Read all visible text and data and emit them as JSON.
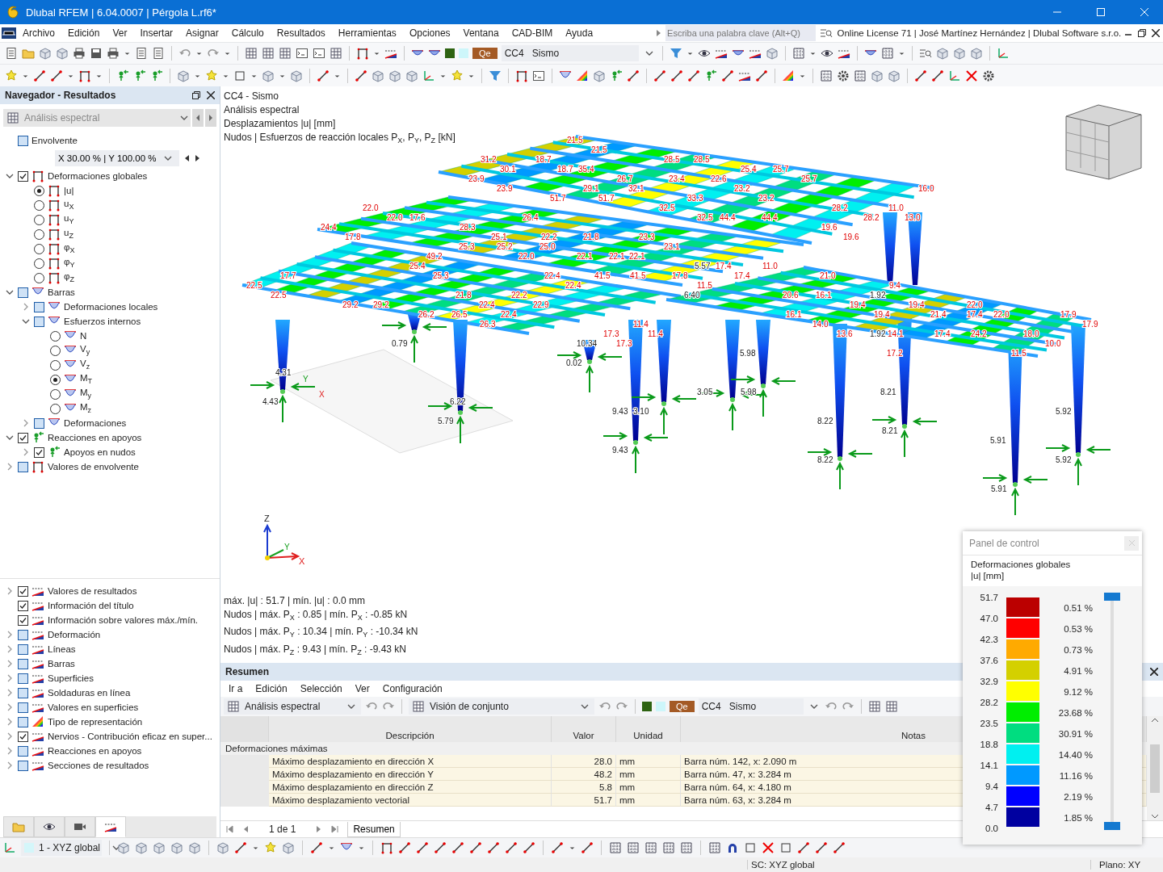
{
  "window": {
    "title": "Dlubal RFEM | 6.04.0007 | Pérgola L.rf6*"
  },
  "menu": [
    "Archivo",
    "Edición",
    "Ver",
    "Insertar",
    "Asignar",
    "Cálculo",
    "Resultados",
    "Herramientas",
    "Opciones",
    "Ventana",
    "CAD-BIM",
    "Ayuda"
  ],
  "search": {
    "placeholder": "Escriba una palabra clave (Alt+Q)"
  },
  "license": "Online License 71 | José Martínez Hernández | Dlubal Software s.r.o.",
  "load_selector": {
    "type": "Qe",
    "case": "CC4",
    "name": "Sismo"
  },
  "navigator": {
    "title": "Navegador - Resultados",
    "analysis": "Análisis espectral",
    "envelope": {
      "label": "Envolvente",
      "checked": false
    },
    "envelope_factors": "X 30.00 % | Y 100.00 %",
    "tree": [
      {
        "label": "Deformaciones globales",
        "kind": "deformation",
        "checked": true,
        "expanded": true,
        "children": [
          {
            "label": "|u|",
            "kind": "deformation",
            "selected": true
          },
          {
            "label": "u$_{X}$",
            "kind": "deformation",
            "selected": false
          },
          {
            "label": "u$_{Y}$",
            "kind": "deformation",
            "selected": false
          },
          {
            "label": "u$_{Z}$",
            "kind": "deformation",
            "selected": false
          },
          {
            "label": "φ$_{X}$",
            "kind": "deformation",
            "selected": false
          },
          {
            "label": "φ$_{Y}$",
            "kind": "deformation",
            "selected": false
          },
          {
            "label": "φ$_{Z}$",
            "kind": "deformation",
            "selected": false
          }
        ]
      },
      {
        "label": "Barras",
        "kind": "member",
        "checked": false,
        "expanded": true,
        "children": [
          {
            "label": "Deformaciones locales",
            "kind": "member",
            "checked": false,
            "expanded": false
          },
          {
            "label": "Esfuerzos internos",
            "kind": "member",
            "checked": false,
            "expanded": true,
            "children": [
              {
                "label": "N",
                "kind": "member",
                "selected": false
              },
              {
                "label": "V$_{y}$",
                "kind": "member",
                "selected": false
              },
              {
                "label": "V$_{z}$",
                "kind": "member",
                "selected": false
              },
              {
                "label": "M$_{T}$",
                "kind": "member",
                "selected": true
              },
              {
                "label": "M$_{y}$",
                "kind": "member",
                "selected": false
              },
              {
                "label": "M$_{z}$",
                "kind": "member",
                "selected": false
              }
            ]
          },
          {
            "label": "Deformaciones",
            "kind": "member",
            "checked": false,
            "expanded": false
          }
        ]
      },
      {
        "label": "Reacciones en apoyos",
        "kind": "reaction",
        "checked": true,
        "expanded": true,
        "children": [
          {
            "label": "Apoyos en nudos",
            "kind": "reaction",
            "checked": true,
            "expanded": false
          }
        ]
      },
      {
        "label": "Valores de envolvente",
        "kind": "deformation",
        "checked": false,
        "expanded": false
      }
    ],
    "display": [
      {
        "label": "Valores de resultados",
        "kind": "values",
        "checked": true,
        "expanded": false
      },
      {
        "label": "Información del título",
        "kind": "display",
        "checked": true
      },
      {
        "label": "Información sobre valores máx./mín.",
        "kind": "display",
        "checked": true
      },
      {
        "label": "Deformación",
        "kind": "display",
        "checked": false,
        "expanded": false
      },
      {
        "label": "Líneas",
        "kind": "display",
        "checked": false,
        "expanded": false
      },
      {
        "label": "Barras",
        "kind": "display",
        "checked": false,
        "expanded": false
      },
      {
        "label": "Superficies",
        "kind": "display",
        "checked": false,
        "expanded": false
      },
      {
        "label": "Soldaduras en línea",
        "kind": "display",
        "checked": false,
        "expanded": false
      },
      {
        "label": "Valores en superficies",
        "kind": "display",
        "checked": false,
        "expanded": false
      },
      {
        "label": "Tipo de representación",
        "kind": "colors",
        "checked": false,
        "expanded": false
      },
      {
        "label": "Nervios - Contribución eficaz en super...",
        "kind": "display",
        "checked": true,
        "expanded": false
      },
      {
        "label": "Reacciones en apoyos",
        "kind": "display",
        "checked": false,
        "expanded": false
      },
      {
        "label": "Secciones de resultados",
        "kind": "display",
        "checked": false,
        "expanded": false
      }
    ],
    "tabs": [
      {
        "kind": "data",
        "selected": false
      },
      {
        "kind": "view",
        "selected": false
      },
      {
        "kind": "camera",
        "selected": false
      },
      {
        "kind": "results",
        "selected": true
      }
    ]
  },
  "viewport": {
    "info": [
      "CC4 - Sismo",
      "Análisis espectral",
      "Desplazamientos |u| [mm]",
      "Nudos | Esfuerzos de reacción locales P$_{X}$, P$_{Y}$, P$_{Z}$ [kN]"
    ],
    "extremes": [
      "máx. |u| : 51.7 | mín. |u| : 0.0 mm",
      "Nudos | máx. P$_{X}$ : 0.85 | mín. P$_{X}$ : -0.85 kN",
      "Nudos | máx. P$_{Y}$ : 10.34 | mín. P$_{Y}$ : -10.34 kN",
      "Nudos | máx. P$_{Z}$ : 9.43 | mín. P$_{Z}$ : -9.43 kN"
    ],
    "axes": [
      "Z",
      "Y",
      "X"
    ],
    "support_axes": [
      "Y",
      "X"
    ],
    "labels": [
      {
        "text": "21.5",
        "kind": "deformation"
      },
      {
        "text": "21.5",
        "kind": "deformation"
      },
      {
        "text": "31.2",
        "kind": "deformation"
      },
      {
        "text": "18.7",
        "kind": "deformation"
      },
      {
        "text": "28.5",
        "kind": "deformation"
      },
      {
        "text": "28.5",
        "kind": "deformation"
      },
      {
        "text": "30.1",
        "kind": "deformation"
      },
      {
        "text": "18.7",
        "kind": "deformation"
      },
      {
        "text": "35.4",
        "kind": "deformation"
      },
      {
        "text": "25.4",
        "kind": "deformation"
      },
      {
        "text": "25.7",
        "kind": "deformation"
      },
      {
        "text": "23.9",
        "kind": "deformation"
      },
      {
        "text": "26.7",
        "kind": "deformation"
      },
      {
        "text": "23.4",
        "kind": "deformation"
      },
      {
        "text": "22.6",
        "kind": "deformation"
      },
      {
        "text": "25.7",
        "kind": "deformation"
      },
      {
        "text": "23.9",
        "kind": "deformation"
      },
      {
        "text": "29.1",
        "kind": "deformation"
      },
      {
        "text": "32.1",
        "kind": "deformation"
      },
      {
        "text": "23.2",
        "kind": "deformation"
      },
      {
        "text": "16.0",
        "kind": "deformation"
      },
      {
        "text": "51.7",
        "kind": "deformation"
      },
      {
        "text": "51.7",
        "kind": "deformation"
      },
      {
        "text": "33.3",
        "kind": "deformation"
      },
      {
        "text": "23.2",
        "kind": "deformation"
      },
      {
        "text": "22.0",
        "kind": "deformation"
      },
      {
        "text": "32.5",
        "kind": "deformation"
      },
      {
        "text": "28.2",
        "kind": "deformation"
      },
      {
        "text": "11.0",
        "kind": "deformation"
      },
      {
        "text": "22.0",
        "kind": "deformation"
      },
      {
        "text": "17.6",
        "kind": "deformation"
      },
      {
        "text": "26.4",
        "kind": "deformation"
      },
      {
        "text": "32.5",
        "kind": "deformation"
      },
      {
        "text": "44.4",
        "kind": "deformation"
      },
      {
        "text": "44.4",
        "kind": "deformation"
      },
      {
        "text": "28.2",
        "kind": "deformation"
      },
      {
        "text": "13.0",
        "kind": "deformation"
      },
      {
        "text": "24.4",
        "kind": "deformation"
      },
      {
        "text": "28.3",
        "kind": "deformation"
      },
      {
        "text": "19.6",
        "kind": "deformation"
      },
      {
        "text": "17.8",
        "kind": "deformation"
      },
      {
        "text": "25.1",
        "kind": "deformation"
      },
      {
        "text": "22.2",
        "kind": "deformation"
      },
      {
        "text": "21.8",
        "kind": "deformation"
      },
      {
        "text": "23.3",
        "kind": "deformation"
      },
      {
        "text": "19.6",
        "kind": "deformation"
      },
      {
        "text": "25.3",
        "kind": "deformation"
      },
      {
        "text": "25.2",
        "kind": "deformation"
      },
      {
        "text": "25.0",
        "kind": "deformation"
      },
      {
        "text": "23.1",
        "kind": "deformation"
      },
      {
        "text": "49.2",
        "kind": "deformation"
      },
      {
        "text": "22.0",
        "kind": "deformation"
      },
      {
        "text": "22.1",
        "kind": "deformation"
      },
      {
        "text": "22.1",
        "kind": "deformation"
      },
      {
        "text": "22.1",
        "kind": "deformation"
      },
      {
        "text": "25.4",
        "kind": "deformation"
      },
      {
        "text": "5.57",
        "kind": "reaction"
      },
      {
        "text": "17.4",
        "kind": "deformation"
      },
      {
        "text": "11.0",
        "kind": "deformation"
      },
      {
        "text": "17.7",
        "kind": "deformation"
      },
      {
        "text": "25.3",
        "kind": "deformation"
      },
      {
        "text": "22.4",
        "kind": "deformation"
      },
      {
        "text": "41.5",
        "kind": "deformation"
      },
      {
        "text": "41.5",
        "kind": "deformation"
      },
      {
        "text": "17.8",
        "kind": "deformation"
      },
      {
        "text": "17.4",
        "kind": "deformation"
      },
      {
        "text": "21.0",
        "kind": "deformation"
      },
      {
        "text": "22.5",
        "kind": "deformation"
      },
      {
        "text": "22.4",
        "kind": "deformation"
      },
      {
        "text": "11.5",
        "kind": "deformation"
      },
      {
        "text": "9.4",
        "kind": "deformation"
      },
      {
        "text": "22.5",
        "kind": "deformation"
      },
      {
        "text": "21.8",
        "kind": "deformation"
      },
      {
        "text": "22.2",
        "kind": "deformation"
      },
      {
        "text": "6.40",
        "kind": "reaction"
      },
      {
        "text": "20.6",
        "kind": "deformation"
      },
      {
        "text": "16.1",
        "kind": "deformation"
      },
      {
        "text": "1.92",
        "kind": "reaction"
      },
      {
        "text": "29.2",
        "kind": "deformation"
      },
      {
        "text": "29.2",
        "kind": "deformation"
      },
      {
        "text": "22.4",
        "kind": "deformation"
      },
      {
        "text": "22.9",
        "kind": "deformation"
      },
      {
        "text": "19.4",
        "kind": "deformation"
      },
      {
        "text": "19.4",
        "kind": "deformation"
      },
      {
        "text": "22.0",
        "kind": "deformation"
      },
      {
        "text": "26.2",
        "kind": "deformation"
      },
      {
        "text": "26.5",
        "kind": "deformation"
      },
      {
        "text": "22.4",
        "kind": "deformation"
      },
      {
        "text": "16.1",
        "kind": "deformation"
      },
      {
        "text": "19.4",
        "kind": "deformation"
      },
      {
        "text": "21.4",
        "kind": "deformation"
      },
      {
        "text": "17.4",
        "kind": "deformation"
      },
      {
        "text": "22.0",
        "kind": "deformation"
      },
      {
        "text": "17.9",
        "kind": "deformation"
      },
      {
        "text": "26.3",
        "kind": "deformation"
      },
      {
        "text": "11.4",
        "kind": "deformation"
      },
      {
        "text": "14.0",
        "kind": "deformation"
      },
      {
        "text": "17.9",
        "kind": "deformation"
      },
      {
        "text": "17.3",
        "kind": "deformation"
      },
      {
        "text": "11.4",
        "kind": "deformation"
      },
      {
        "text": "13.6",
        "kind": "deformation"
      },
      {
        "text": "1.92",
        "kind": "reaction"
      },
      {
        "text": "14.1",
        "kind": "deformation"
      },
      {
        "text": "17.4",
        "kind": "deformation"
      },
      {
        "text": "24.2",
        "kind": "deformation"
      },
      {
        "text": "18.0",
        "kind": "deformation"
      },
      {
        "text": "0.79",
        "kind": "reaction"
      },
      {
        "text": "10.34",
        "kind": "reaction"
      },
      {
        "text": "17.3",
        "kind": "deformation"
      },
      {
        "text": "10.0",
        "kind": "deformation"
      },
      {
        "text": "5.98",
        "kind": "reaction"
      },
      {
        "text": "17.2",
        "kind": "deformation"
      },
      {
        "text": "11.5",
        "kind": "deformation"
      },
      {
        "text": "0.02",
        "kind": "reaction"
      },
      {
        "text": "4.31",
        "kind": "reaction"
      },
      {
        "text": "3.05",
        "kind": "reaction"
      },
      {
        "text": "5.98",
        "kind": "reaction"
      },
      {
        "text": "8.21",
        "kind": "reaction"
      },
      {
        "text": "4.43",
        "kind": "reaction"
      },
      {
        "text": "6.22",
        "kind": "reaction"
      },
      {
        "text": "9.43",
        "kind": "reaction"
      },
      {
        "text": "3.10",
        "kind": "reaction"
      },
      {
        "text": "5.92",
        "kind": "reaction"
      },
      {
        "text": "5.79",
        "kind": "reaction"
      },
      {
        "text": "8.22",
        "kind": "reaction"
      },
      {
        "text": "8.21",
        "kind": "reaction"
      },
      {
        "text": "5.91",
        "kind": "reaction"
      },
      {
        "text": "9.43",
        "kind": "reaction"
      },
      {
        "text": "8.22",
        "kind": "reaction"
      },
      {
        "text": "5.92",
        "kind": "reaction"
      },
      {
        "text": "5.91",
        "kind": "reaction"
      }
    ]
  },
  "summary": {
    "title": "Resumen",
    "menu": [
      "Ir a",
      "Edición",
      "Selección",
      "Ver",
      "Configuración"
    ],
    "analysis": "Análisis espectral",
    "view": "Visión de conjunto",
    "load_selector": {
      "type": "Qe",
      "case": "CC4",
      "name": "Sismo"
    },
    "columns": [
      "Descripción",
      "Valor",
      "Unidad",
      "Notas"
    ],
    "group": "Deformaciones máximas",
    "rows": [
      {
        "description": "Máximo desplazamiento en dirección X",
        "value": "28.0",
        "unit": "mm",
        "notes": "Barra núm. 142, x: 2.090 m"
      },
      {
        "description": "Máximo desplazamiento en dirección Y",
        "value": "48.2",
        "unit": "mm",
        "notes": "Barra núm. 47, x: 3.284 m"
      },
      {
        "description": "Máximo desplazamiento en dirección Z",
        "value": "5.8",
        "unit": "mm",
        "notes": "Barra núm. 64, x: 4.180 m"
      },
      {
        "description": "Máximo desplazamiento vectorial",
        "value": "51.7",
        "unit": "mm",
        "notes": "Barra núm. 63, x: 3.284 m"
      }
    ],
    "pager": "1 de 1",
    "tab": "Resumen"
  },
  "control_panel": {
    "title": "Panel de control",
    "slider": {
      "level": 1
    },
    "heading": "Deformaciones globales",
    "unit": "|u| [mm]",
    "scale": [
      "51.7",
      "47.0",
      "42.3",
      "37.6",
      "32.9",
      "28.2",
      "23.5",
      "18.8",
      "14.1",
      "9.4",
      "4.7",
      "0.0"
    ],
    "bands": [
      {
        "color": "#bb0000",
        "share": "0.51 %"
      },
      {
        "color": "#ff0000",
        "share": "0.53 %"
      },
      {
        "color": "#ffaa00",
        "share": "0.73 %"
      },
      {
        "color": "#d4d000",
        "share": "4.91 %"
      },
      {
        "color": "#ffff00",
        "share": "9.12 %"
      },
      {
        "color": "#00ee00",
        "share": "23.68 %"
      },
      {
        "color": "#00dd80",
        "share": "30.91 %"
      },
      {
        "color": "#00f0f0",
        "share": "14.40 %"
      },
      {
        "color": "#0099ff",
        "share": "11.16 %"
      },
      {
        "color": "#0000ff",
        "share": "2.19 %"
      },
      {
        "color": "#0000a0",
        "share": "1.85 %"
      }
    ]
  },
  "coordinate_system": "1 - XYZ global",
  "status": {
    "coordinate_system": "SC: XYZ global",
    "plane": "Plano: XY"
  }
}
